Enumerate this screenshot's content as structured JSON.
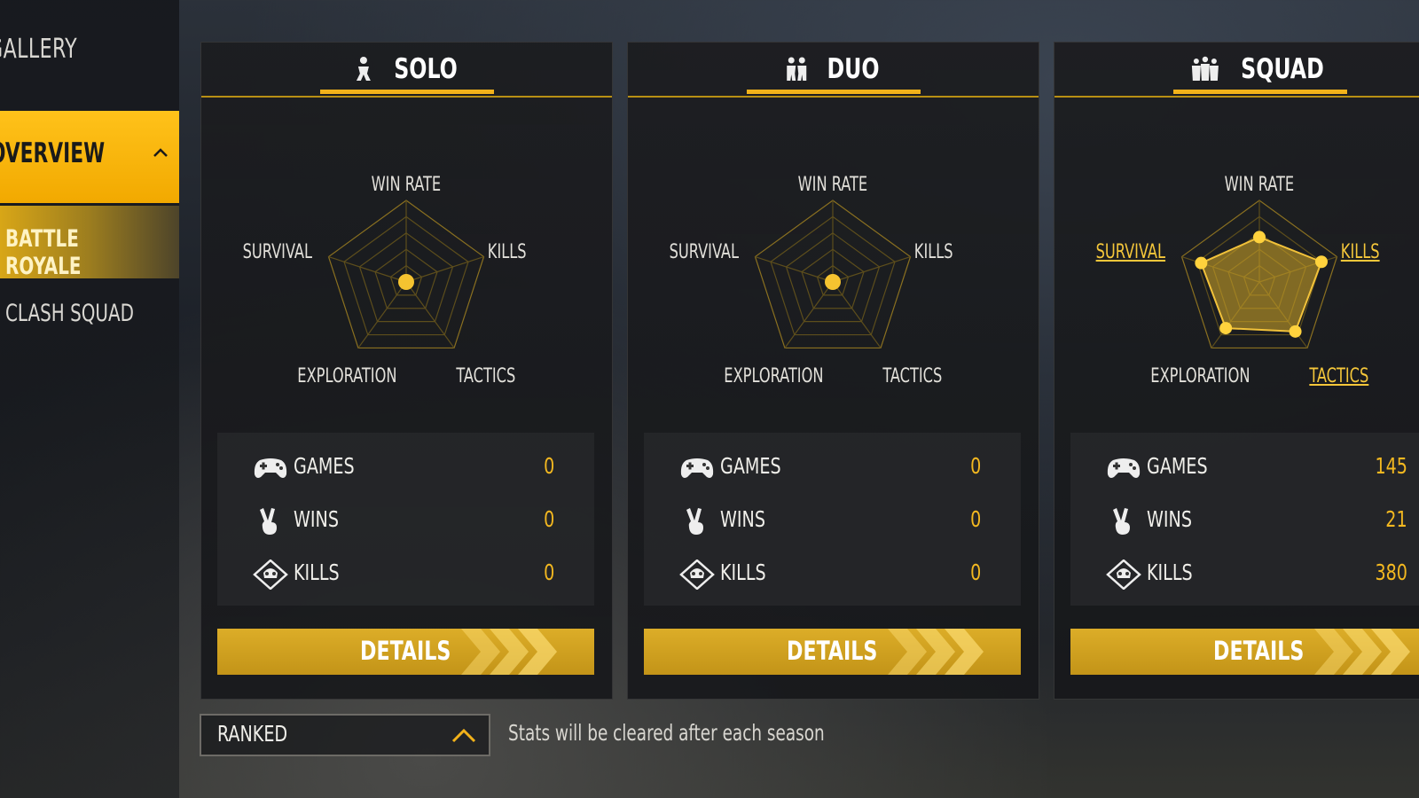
{
  "sidebar": {
    "gallery": "GALLERY",
    "overview": "OVERVIEW",
    "battle_royale": "BATTLE ROYALE",
    "clash_squad": "CLASH SQUAD"
  },
  "colors": {
    "accent": "#f2b21a",
    "value": "#f3b820",
    "details_bg": "#cfa020"
  },
  "radar_labels": {
    "win_rate": "WIN RATE",
    "kills": "KILLS",
    "survival": "SURVIVAL",
    "exploration": "EXPLORATION",
    "tactics": "TACTICS"
  },
  "modes": [
    {
      "title": "SOLO",
      "icon": "solo-player-icon",
      "stats": {
        "games_label": "GAMES",
        "games": "0",
        "wins_label": "WINS",
        "wins": "0",
        "kills_label": "KILLS",
        "kills": "0"
      },
      "details": "DETAILS",
      "radar": {
        "win_rate": 0,
        "kills": 0,
        "tactics": 0,
        "exploration": 0,
        "survival": 0
      }
    },
    {
      "title": "DUO",
      "icon": "duo-players-icon",
      "stats": {
        "games_label": "GAMES",
        "games": "0",
        "wins_label": "WINS",
        "wins": "0",
        "kills_label": "KILLS",
        "kills": "0"
      },
      "details": "DETAILS",
      "radar": {
        "win_rate": 0,
        "kills": 0,
        "tactics": 0,
        "exploration": 0,
        "survival": 0
      }
    },
    {
      "title": "SQUAD",
      "icon": "squad-players-icon",
      "stats": {
        "games_label": "GAMES",
        "games": "145",
        "wins_label": "WINS",
        "wins": "21",
        "kills_label": "KILLS",
        "kills": "380"
      },
      "details": "DETAILS",
      "radar": {
        "win_rate": 0.55,
        "kills": 0.8,
        "tactics": 0.75,
        "exploration": 0.7,
        "survival": 0.75
      }
    }
  ],
  "bottom": {
    "mode_select": "RANKED",
    "note": "Stats will be cleared after each season"
  }
}
